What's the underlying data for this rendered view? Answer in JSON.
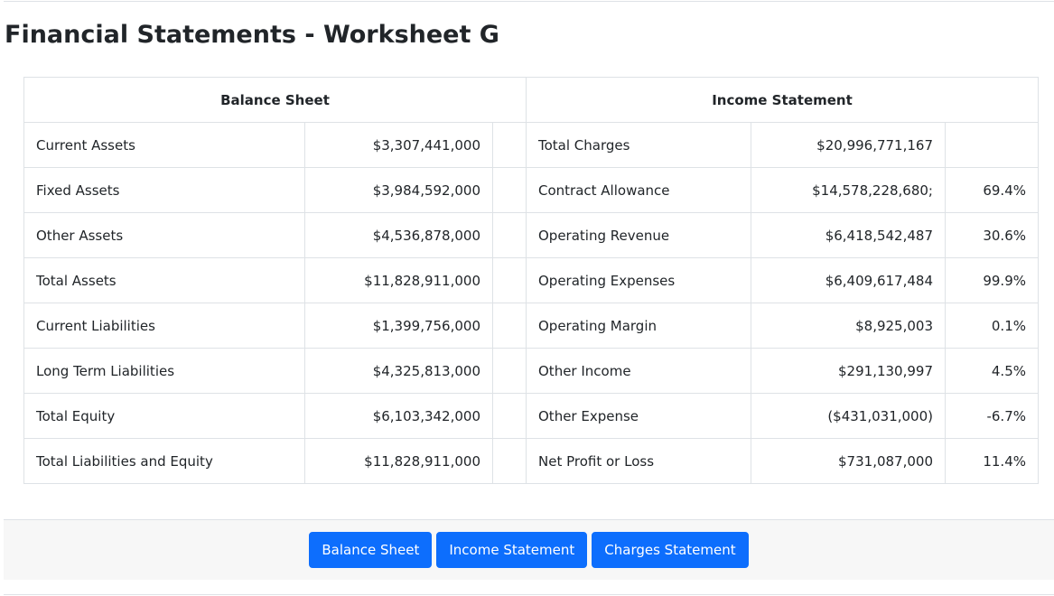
{
  "page": {
    "title": "Financial Statements - Worksheet G"
  },
  "table": {
    "balance_header": "Balance Sheet",
    "income_header": "Income Statement",
    "rows": [
      {
        "bs_label": "Current Assets",
        "bs_value": "$3,307,441,000",
        "is_label": "Total Charges",
        "is_value": "$20,996,771,167",
        "is_pct": ""
      },
      {
        "bs_label": "Fixed Assets",
        "bs_value": "$3,984,592,000",
        "is_label": "Contract Allowance",
        "is_value": "$14,578,228,680;",
        "is_pct": "69.4%"
      },
      {
        "bs_label": "Other Assets",
        "bs_value": "$4,536,878,000",
        "is_label": "Operating Revenue",
        "is_value": "$6,418,542,487",
        "is_pct": "30.6%"
      },
      {
        "bs_label": "Total Assets",
        "bs_value": "$11,828,911,000",
        "is_label": "Operating Expenses",
        "is_value": "$6,409,617,484",
        "is_pct": "99.9%"
      },
      {
        "bs_label": "Current Liabilities",
        "bs_value": "$1,399,756,000",
        "is_label": "Operating Margin",
        "is_value": "$8,925,003",
        "is_pct": "0.1%"
      },
      {
        "bs_label": "Long Term Liabilities",
        "bs_value": "$4,325,813,000",
        "is_label": "Other Income",
        "is_value": "$291,130,997",
        "is_pct": "4.5%"
      },
      {
        "bs_label": "Total Equity",
        "bs_value": "$6,103,342,000",
        "is_label": "Other Expense",
        "is_value": "($431,031,000)",
        "is_pct": "-6.7%"
      },
      {
        "bs_label": "Total Liabilities and Equity",
        "bs_value": "$11,828,911,000",
        "is_label": "Net Profit or Loss",
        "is_value": "$731,087,000",
        "is_pct": "11.4%"
      }
    ]
  },
  "footer": {
    "buttons": [
      "Balance Sheet",
      "Income Statement",
      "Charges Statement"
    ]
  },
  "colors": {
    "button_bg": "#0d6efd",
    "button_text": "#ffffff",
    "border": "#dee2e6",
    "footer_bg": "#f7f7f7"
  }
}
